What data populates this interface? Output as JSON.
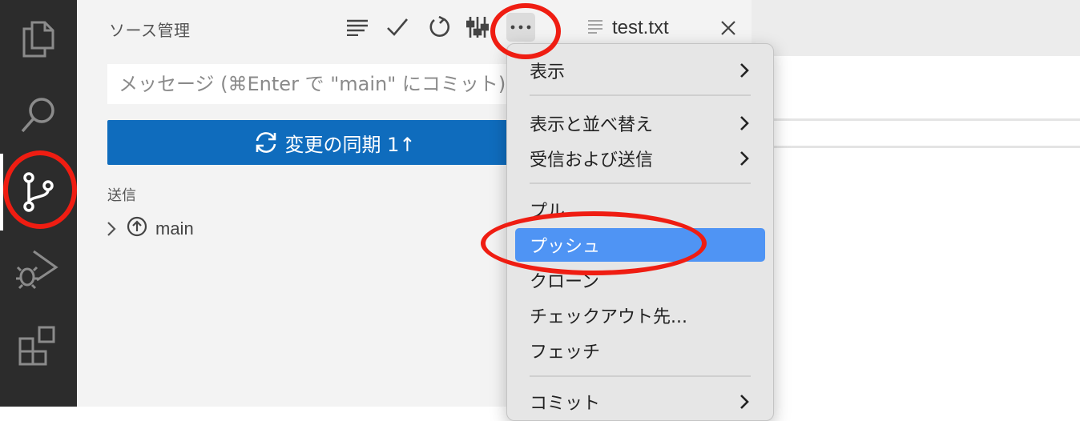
{
  "sidebar": {
    "title": "ソース管理",
    "commit_placeholder": "メッセージ (⌘Enter で \"main\" にコミット)",
    "sync_button_label": "変更の同期 1↑",
    "section_label": "送信",
    "branch_name": "main"
  },
  "activity_bar": {
    "items": [
      {
        "icon": "files-icon"
      },
      {
        "icon": "search-icon"
      },
      {
        "icon": "source-control-icon",
        "active": true
      },
      {
        "icon": "run-debug-icon"
      },
      {
        "icon": "extensions-icon"
      }
    ]
  },
  "toolbar": {
    "buttons": [
      "view-as-list-icon",
      "commit-check-icon",
      "refresh-icon",
      "graph-icon",
      "more-actions-icon"
    ]
  },
  "tab": {
    "label": "test.txt"
  },
  "menu": {
    "items": [
      {
        "label": "表示",
        "submenu": true
      },
      {
        "label": "表示と並べ替え",
        "submenu": true
      },
      {
        "label": "受信および送信",
        "submenu": true
      },
      {
        "label": "プル",
        "submenu": false
      },
      {
        "label": "プッシュ",
        "submenu": false,
        "selected": true
      },
      {
        "label": "クローン",
        "submenu": false
      },
      {
        "label": "チェックアウト先...",
        "submenu": false
      },
      {
        "label": "フェッチ",
        "submenu": false
      },
      {
        "label": "コミット",
        "submenu": true
      }
    ]
  },
  "colors": {
    "accent_button": "#0f6cbd",
    "menu_selected": "#4f94f4",
    "annotation": "#ef1d12",
    "activity_bar": "#2c2c2c"
  }
}
